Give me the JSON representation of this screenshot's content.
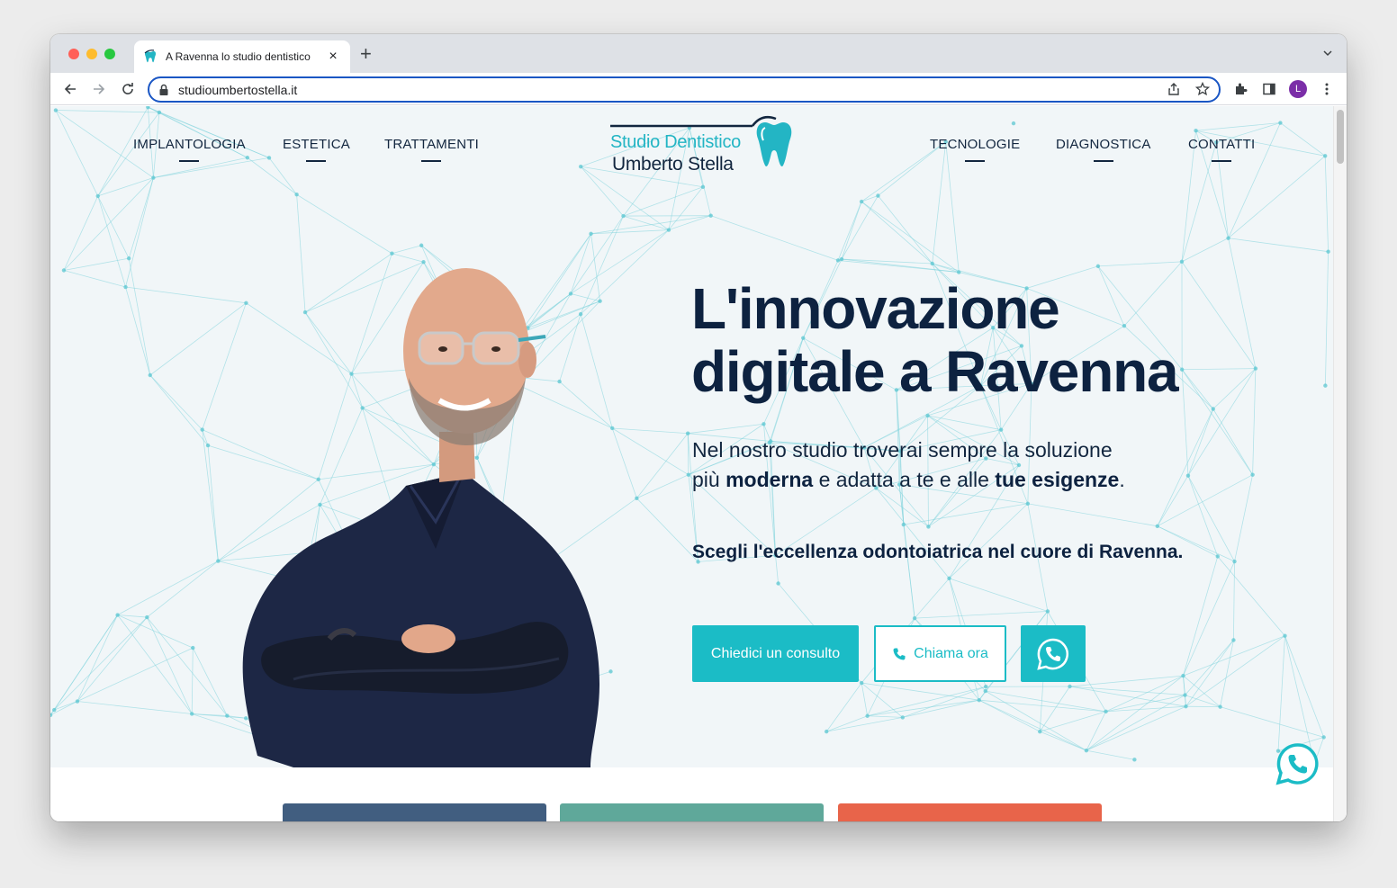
{
  "browser": {
    "tab_title": "A Ravenna lo studio dentistico",
    "tab_close": "×",
    "new_tab": "+",
    "url": "studioumbertostella.it",
    "profile_initial": "L"
  },
  "nav": {
    "left": [
      "IMPLANTOLOGIA",
      "ESTETICA",
      "TRATTAMENTI"
    ],
    "right": [
      "TECNOLOGIE",
      "DIAGNOSTICA",
      "CONTATTI"
    ]
  },
  "logo": {
    "line1": "Studio Dentistico",
    "line2": "Umberto Stella"
  },
  "hero": {
    "headline_line1": "L'innovazione",
    "headline_line2": "digitale a Ravenna",
    "sub_part1": "Nel nostro studio troverai sempre la soluzione",
    "sub_part2": "più ",
    "sub_bold1": "moderna",
    "sub_part3": " e adatta a te e alle ",
    "sub_bold2": "tue esigenze",
    "sub_part4": ".",
    "tagline": "Scegli l'eccellenza odontoiatrica nel cuore di Ravenna."
  },
  "buttons": {
    "consult": "Chiedici un consulto",
    "call": "Chiama ora"
  },
  "colors": {
    "accent": "#1bbcc6",
    "navy": "#0d2240",
    "card_1": "#415e80",
    "card_2": "#5fa89a",
    "card_3": "#e8644a"
  },
  "icons": [
    "back-arrow-icon",
    "forward-arrow-icon",
    "reload-icon",
    "lock-icon",
    "share-icon",
    "star-icon",
    "extensions-icon",
    "sidepanel-icon",
    "menu-dots-icon",
    "phone-icon",
    "whatsapp-icon",
    "tooth-icon"
  ]
}
